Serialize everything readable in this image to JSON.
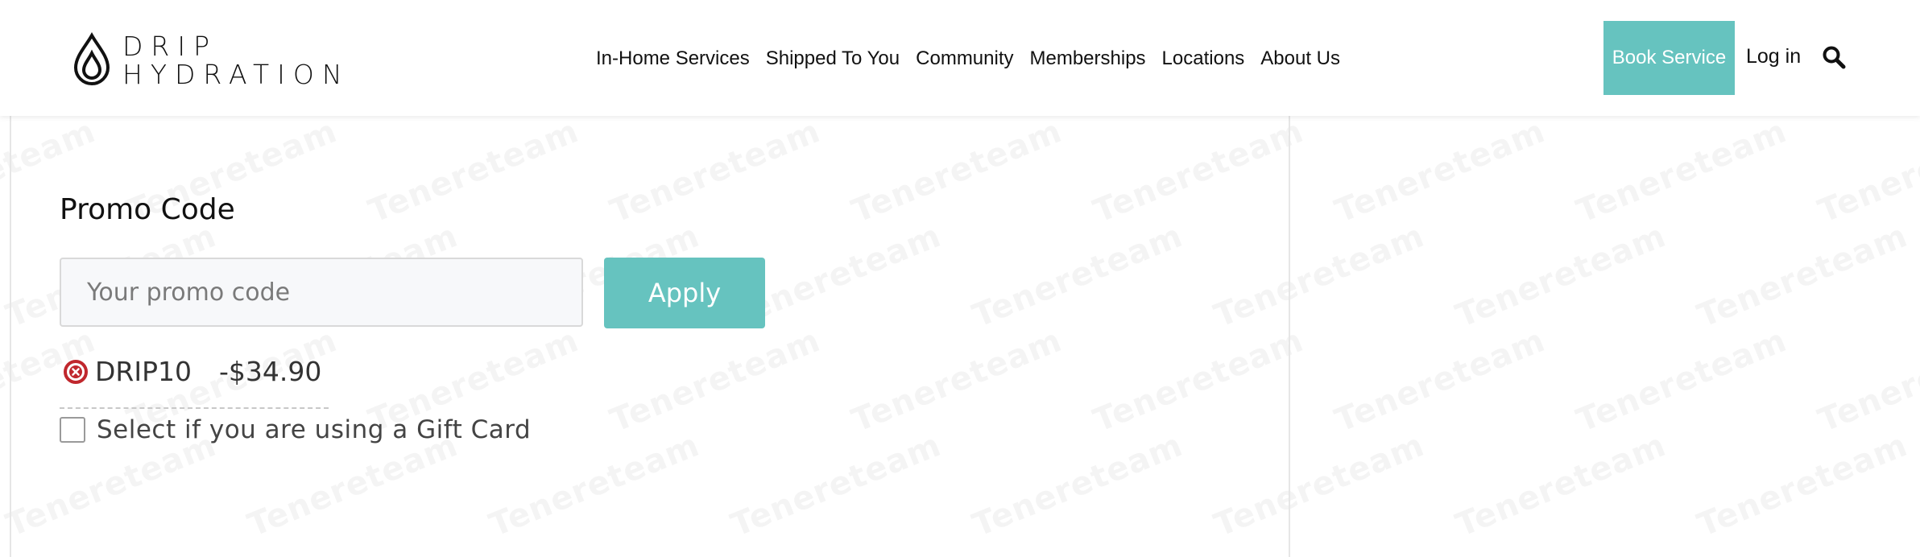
{
  "watermark": {
    "text": "Tenereteam"
  },
  "header": {
    "logo": {
      "line1": "DRIP",
      "line2": "HYDRATION"
    },
    "nav": [
      {
        "label": "In-Home Services"
      },
      {
        "label": "Shipped To You"
      },
      {
        "label": "Community"
      },
      {
        "label": "Memberships"
      },
      {
        "label": "Locations"
      },
      {
        "label": "About Us"
      }
    ],
    "book_label": "Book Service",
    "login_label": "Log in",
    "search_icon": "search-icon"
  },
  "promo": {
    "title": "Promo Code",
    "placeholder": "Your promo code",
    "value": "",
    "apply_label": "Apply",
    "applied_code": "DRIP10",
    "applied_discount": "-$34.90",
    "remove_icon": "remove-circle-icon"
  },
  "gift": {
    "label": "Select if you are using a Gift Card",
    "checked": false
  },
  "colors": {
    "accent": "#66c3bf",
    "remove": "#c0272d"
  }
}
